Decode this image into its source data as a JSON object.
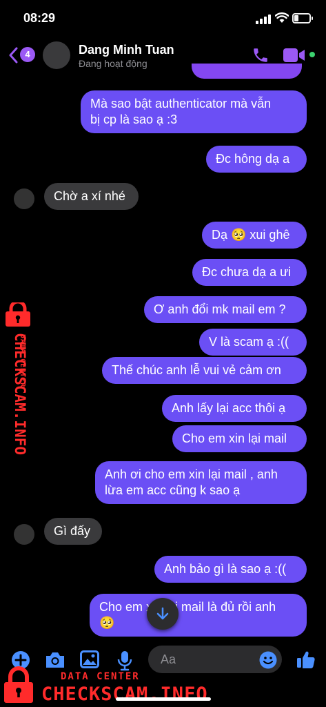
{
  "status_bar": {
    "time": "08:29",
    "icons": [
      "signal-icon",
      "wifi-icon",
      "battery-icon"
    ]
  },
  "header": {
    "back_count": "4",
    "contact_name": "Dang Minh Tuan",
    "contact_status": "Đang hoạt động",
    "icons": [
      "back-chevron-icon",
      "phone-icon",
      "video-camera-icon"
    ]
  },
  "messages": [
    {
      "dir": "out",
      "lines": [
        "Mà sao bật authenticator mà vẫn",
        "bị cp là sao ạ :3"
      ]
    },
    {
      "dir": "out",
      "text": "Đc hông dạ a"
    },
    {
      "dir": "in",
      "text": "Chờ a xí nhé"
    },
    {
      "dir": "out",
      "text": "Dạ 🥺 xui ghê"
    },
    {
      "dir": "out",
      "text": "Đc chưa dạ a ưi"
    },
    {
      "dir": "out",
      "text": "Ơ anh đổi mk mail em ?"
    },
    {
      "dir": "out",
      "text": "V là scam ạ :(("
    },
    {
      "dir": "out",
      "text": "Thế chúc anh lễ vui vẻ cảm ơn"
    },
    {
      "dir": "out",
      "text": "Anh lấy lại acc thôi ạ"
    },
    {
      "dir": "out",
      "text": "Cho em xin lại mail"
    },
    {
      "dir": "out",
      "lines": [
        "Anh ơi cho em xin lại mail , anh",
        "lừa em acc cũng k sao ạ"
      ]
    },
    {
      "dir": "in",
      "text": "Gì đấy"
    },
    {
      "dir": "out",
      "text": "Anh bảo gì là sao ạ :(("
    },
    {
      "dir": "out",
      "lines": [
        "Cho em xin lại mail là đủ rồi anh",
        "🥺"
      ]
    }
  ],
  "composer": {
    "placeholder": "Aa",
    "icons": [
      "plus-icon",
      "camera-icon",
      "image-icon",
      "microphone-icon",
      "emoji-icon",
      "thumbs-up-icon"
    ]
  },
  "watermark": {
    "small": "DATA CENTER",
    "big": "CHECKSCAM.INFO"
  },
  "colors": {
    "outgoing_bubble": "#6b4ff5",
    "incoming_bubble": "#3a3a3c",
    "accent": "#9b59f5",
    "watermark": "#ff2b2b"
  }
}
